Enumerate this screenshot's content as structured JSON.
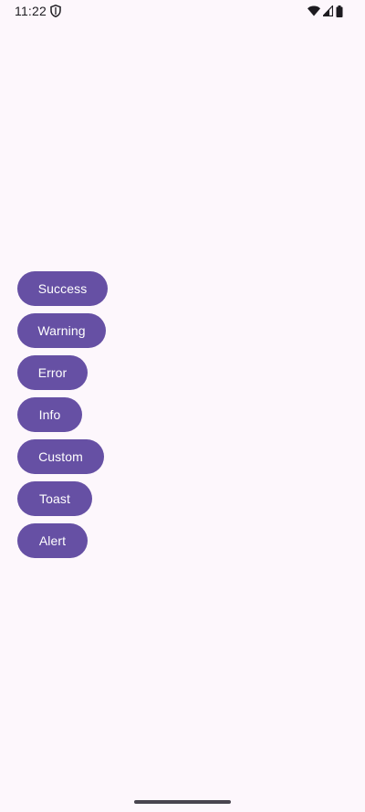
{
  "status_bar": {
    "time": "11:22",
    "icons": [
      "shield-icon",
      "wifi-icon",
      "cellular-signal-icon",
      "battery-icon"
    ]
  },
  "buttons": [
    {
      "label": "Success"
    },
    {
      "label": "Warning"
    },
    {
      "label": "Error"
    },
    {
      "label": "Info"
    },
    {
      "label": "Custom"
    },
    {
      "label": "Toast"
    },
    {
      "label": "Alert"
    }
  ],
  "colors": {
    "background": "#fdf7fc",
    "button": "#6650a4",
    "button_text": "#ffffff",
    "status_text": "#1d1b20"
  }
}
